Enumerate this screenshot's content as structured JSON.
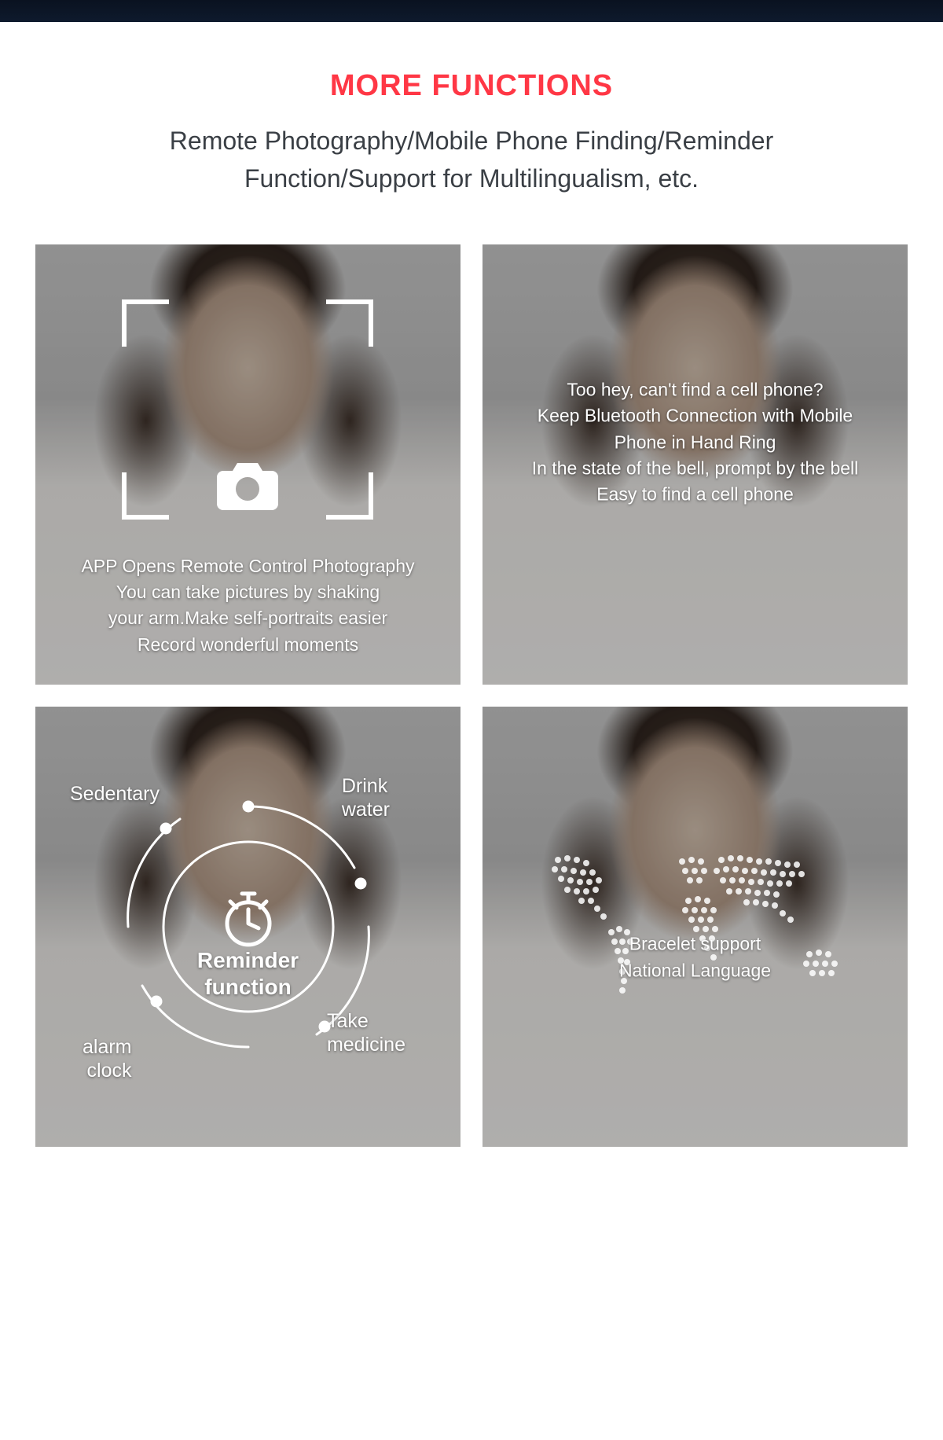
{
  "header": {
    "title": "MORE FUNCTIONS",
    "subtitle": "Remote Photography/Mobile Phone Finding/Reminder Function/Support for Multilingualism, etc."
  },
  "cards": {
    "remote_photo": {
      "caption": "APP Opens Remote Control Photography\nYou can take pictures by shaking\nyour arm.Make self-portraits easier\nRecord wonderful moments"
    },
    "find_phone": {
      "caption": "Too hey, can't find a cell phone?\nKeep Bluetooth Connection with Mobile\nPhone in Hand Ring\nIn the state of the bell, prompt by the bell\nEasy to find a cell phone"
    },
    "reminder": {
      "center_label": "Reminder\nfunction",
      "labels": {
        "sedentary": "Sedentary",
        "drink_water": "Drink\nwater",
        "alarm_clock": "alarm\nclock",
        "take_medicine": "Take\nmedicine"
      }
    },
    "multilingual": {
      "caption": "Bracelet support\nNational Language"
    }
  },
  "colors": {
    "accent": "#ff3745",
    "text": "#3a3f45",
    "dark_bar": "#0a1220"
  }
}
